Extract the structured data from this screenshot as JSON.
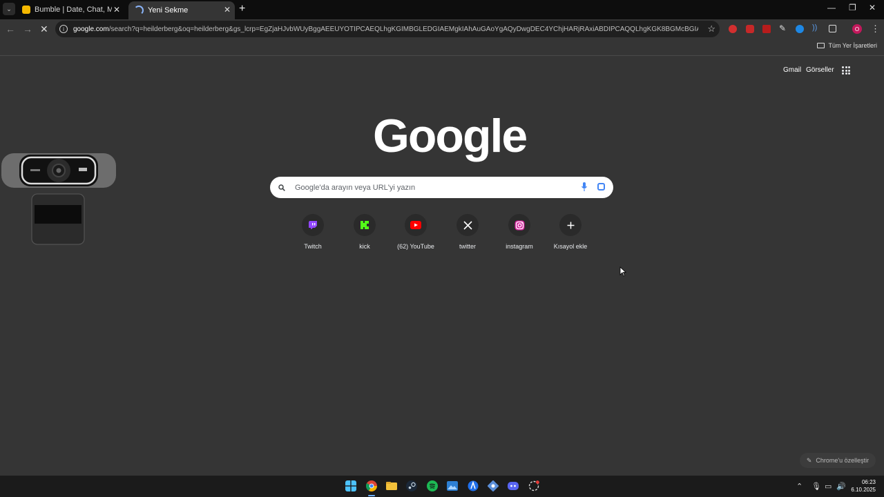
{
  "browser": {
    "tabs": [
      {
        "title": "Bumble | Date, Chat, Meet New"
      },
      {
        "title": "Yeni Sekme"
      }
    ],
    "omnibox": {
      "domain": "google.com",
      "path": "/search?q=heilderberg&oq=heilderberg&gs_lcrp=EgZjaHJvbWUyBggAEEUYOTIPCAEQLhgKGIMBGLEDGIAEMgkIAhAuGAoYgAQyDwgDEC4YChjHARjRAxiABDIPCAQQLhgKGK8BGMcBGIAEMgkIBRAAGAoYgAQ..."
    },
    "bookmarks": {
      "all_label": "Tüm Yer İşaretleri"
    },
    "profile_initial": "O"
  },
  "page": {
    "top_links": {
      "gmail": "Gmail",
      "images": "Görseller"
    },
    "logo_text": "Google",
    "search": {
      "placeholder": "Google'da arayın veya URL'yi yazın"
    },
    "shortcuts": [
      {
        "label": "Twitch",
        "icon": "twitch-icon",
        "color": "#9146ff"
      },
      {
        "label": "kick",
        "icon": "kick-icon",
        "color": "#53fc18"
      },
      {
        "label": "(62) YouTube",
        "icon": "youtube-icon",
        "color": "#ff0000"
      },
      {
        "label": "twitter",
        "icon": "x-icon",
        "color": "#ffffff"
      },
      {
        "label": "instagram",
        "icon": "instagram-icon",
        "color": "#e1306c"
      },
      {
        "label": "Kısayol ekle",
        "icon": "plus-icon",
        "color": "#ffffff"
      }
    ],
    "customize_label": "Chrome'u özelleştir"
  },
  "taskbar": {
    "time": "06:23",
    "date": "6.10.2025"
  }
}
